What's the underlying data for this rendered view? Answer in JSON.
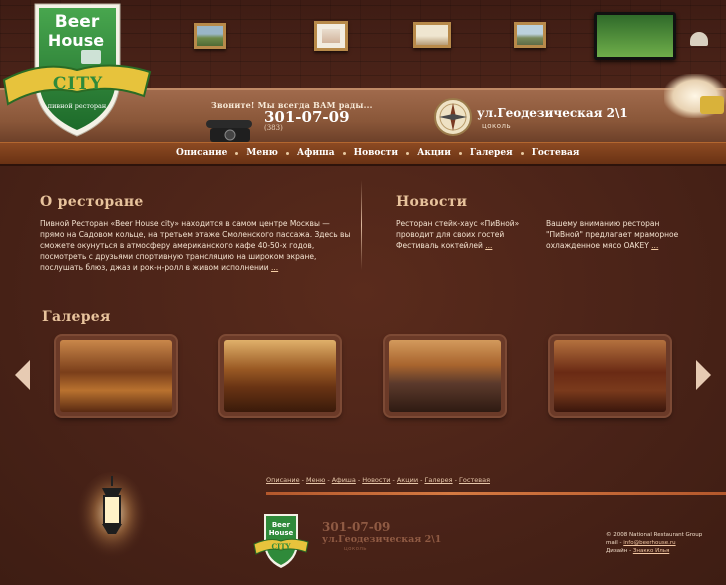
{
  "logo": {
    "beer": "Beer",
    "house": "House",
    "city": "CITY",
    "tagline": "пивной ресторан"
  },
  "header": {
    "call_text": "Звоните! Мы всегда ВАМ рады...",
    "phone": "301-07-09",
    "phone_code": "(383)",
    "address": "ул.Геодезическая 2\\1",
    "address_sub": "цоколь"
  },
  "nav": [
    "Описание",
    "Меню",
    "Афиша",
    "Новости",
    "Акции",
    "Галерея",
    "Гостевая"
  ],
  "about": {
    "title": "О ресторане",
    "lines": [
      "Пивной Ресторан «Beer House city» находится в самом центре Москвы —",
      "прямо на Садовом кольце, на третьем этаже Смоленского пассажа. Здесь вы",
      "сможете окунуться в атмосферу американского кафе 40-50-х годов,",
      "посмотреть с друзьями спортивную трансляцию на широком экране,",
      "послушать блюз, джаз и рок-н-ролл в живом исполнении"
    ],
    "more": "..."
  },
  "news": {
    "title": "Новости",
    "items": [
      {
        "lines": [
          "Ресторан стейк-хаус «ПиВной»",
          "проводит для своих гостей",
          "Фестиваль коктейлей"
        ],
        "more": "..."
      },
      {
        "lines": [
          "Вашему вниманию ресторан",
          "\"ПиВной\" предлагает мраморное",
          "охлажденное мясо OAKEY"
        ],
        "more": "..."
      }
    ]
  },
  "gallery": {
    "title": "Галерея"
  },
  "footer": {
    "links": [
      "Описание",
      "Меню",
      "Афиша",
      "Новости",
      "Акции",
      "Галерея",
      "Гостевая"
    ],
    "phone": "301-07-09",
    "address": "ул.Геодезическая 2\\1",
    "address_sub": "цоколь",
    "copyright": "© 2008 National Restaurant Group",
    "mail_label": "mail - ",
    "mail": "info@beerhouse.ru",
    "design_label": "Дизайн - ",
    "designer": "Знакко Илья"
  },
  "colors": {
    "accent": "#e8c39c",
    "background": "#4a2418",
    "nav_shelf": "#8c4a22",
    "logo_green": "#2f8a3a",
    "logo_yellow": "#e8c23a"
  }
}
